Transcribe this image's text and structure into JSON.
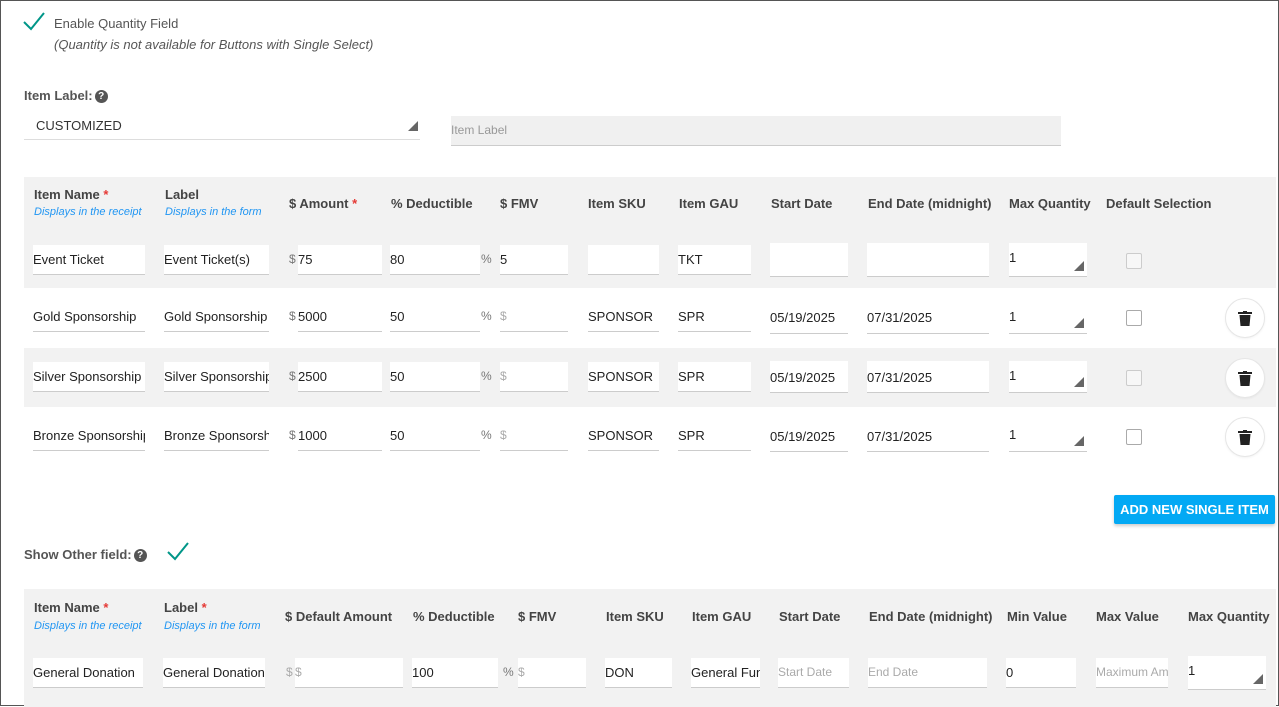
{
  "quantity": {
    "enable_label": "Enable Quantity Field",
    "note": "(Quantity is not available for Buttons with Single Select)"
  },
  "item_label": {
    "label": "Item Label:",
    "select_value": "CUSTOMIZED",
    "input_placeholder": "Item Label"
  },
  "single_items": {
    "headers": {
      "item_name": "Item Name",
      "item_name_sub": "Displays in the receipt",
      "label": "Label",
      "label_sub": "Displays in the form",
      "amount": "$ Amount",
      "deductible": "% Deductible",
      "fmv": "$ FMV",
      "sku": "Item SKU",
      "gau": "Item GAU",
      "start": "Start Date",
      "end": "End Date (midnight)",
      "maxq": "Max Quantity",
      "default": "Default Selection",
      "required_mark": "*"
    },
    "currency": "$",
    "percent": "%",
    "rows": [
      {
        "name": "Event Ticket",
        "label": "Event Ticket(s)",
        "amount": "75",
        "deductible": "80",
        "fmv": "5",
        "sku": "",
        "gau": "TKT",
        "start": "",
        "end": "",
        "maxq": "1"
      },
      {
        "name": "Gold Sponsorship",
        "label": "Gold Sponsorship",
        "amount": "5000",
        "deductible": "50",
        "fmv": "",
        "sku": "SPONSOR",
        "gau": "SPR",
        "start": "05/19/2025",
        "end": "07/31/2025",
        "maxq": "1"
      },
      {
        "name": "Silver Sponsorship",
        "label": "Silver Sponsorship",
        "amount": "2500",
        "deductible": "50",
        "fmv": "",
        "sku": "SPONSOR",
        "gau": "SPR",
        "start": "05/19/2025",
        "end": "07/31/2025",
        "maxq": "1"
      },
      {
        "name": "Bronze Sponsorship",
        "label": "Bronze Sponsorship",
        "amount": "1000",
        "deductible": "50",
        "fmv": "",
        "sku": "SPONSOR",
        "gau": "SPR",
        "start": "05/19/2025",
        "end": "07/31/2025",
        "maxq": "1"
      }
    ],
    "add_button": "ADD NEW SINGLE ITEM"
  },
  "other_field": {
    "label": "Show Other field:",
    "headers": {
      "item_name": "Item Name",
      "item_name_sub": "Displays in the receipt",
      "label": "Label",
      "label_sub": "Displays in the form",
      "default_amount": "$ Default Amount",
      "deductible": "% Deductible",
      "fmv": "$ FMV",
      "sku": "Item SKU",
      "gau": "Item GAU",
      "start": "Start Date",
      "end": "End Date (midnight)",
      "min": "Min Value",
      "max": "Max Value",
      "maxq": "Max Quantity"
    },
    "row": {
      "name": "General Donation",
      "label": "General Donation",
      "default_amount_placeholder": "$",
      "deductible": "100",
      "fmv_placeholder": "$",
      "sku": "DON",
      "gau": "General Fund",
      "start_placeholder": "Start Date",
      "end_placeholder": "End Date",
      "min": "0",
      "max_placeholder": "Maximum Amount",
      "maxq": "1"
    }
  },
  "colors": {
    "accent": "#03a9f4",
    "check": "#009688",
    "required": "#e53935",
    "hint": "#2196f3"
  }
}
